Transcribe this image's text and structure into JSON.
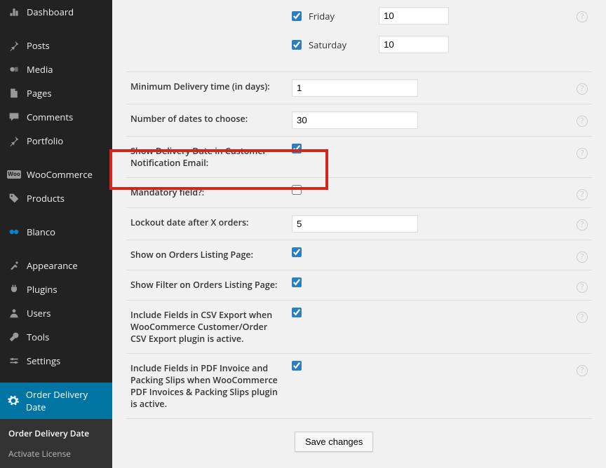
{
  "sidebar": {
    "items": [
      {
        "label": "Dashboard"
      },
      {
        "label": "Posts"
      },
      {
        "label": "Media"
      },
      {
        "label": "Pages"
      },
      {
        "label": "Comments"
      },
      {
        "label": "Portfolio"
      },
      {
        "label": "WooCommerce"
      },
      {
        "label": "Products"
      },
      {
        "label": "Blanco"
      },
      {
        "label": "Appearance"
      },
      {
        "label": "Plugins"
      },
      {
        "label": "Users"
      },
      {
        "label": "Tools"
      },
      {
        "label": "Settings"
      },
      {
        "label": "Order Delivery Date"
      }
    ],
    "submenu": {
      "items": [
        {
          "label": "Order Delivery Date"
        },
        {
          "label": "Activate License"
        }
      ]
    }
  },
  "settings": {
    "days": {
      "friday": {
        "label": "Friday",
        "value": "10",
        "checked": true
      },
      "saturday": {
        "label": "Saturday",
        "value": "10",
        "checked": true
      }
    },
    "rows": {
      "min_delivery": {
        "label": "Minimum Delivery time (in days):",
        "value": "1"
      },
      "num_dates": {
        "label": "Number of dates to choose:",
        "value": "30"
      },
      "show_email": {
        "label": "Show Delivery Date in Customer Notification Email:",
        "checked": true
      },
      "mandatory": {
        "label": "Mandatory field?:",
        "checked": false
      },
      "lockout": {
        "label": "Lockout date after X orders:",
        "value": "5"
      },
      "show_listing": {
        "label": "Show on Orders Listing Page:",
        "checked": true
      },
      "show_filter": {
        "label": "Show Filter on Orders Listing Page:",
        "checked": true
      },
      "csv_export": {
        "label": "Include Fields in CSV Export when WooCommerce Customer/Order CSV Export plugin is active.",
        "checked": true
      },
      "pdf_invoice": {
        "label": "Include Fields in PDF Invoice and Packing Slips when WooCommerce PDF Invoices & Packing Slips plugin is active.",
        "checked": true
      }
    },
    "save_label": "Save changes"
  }
}
